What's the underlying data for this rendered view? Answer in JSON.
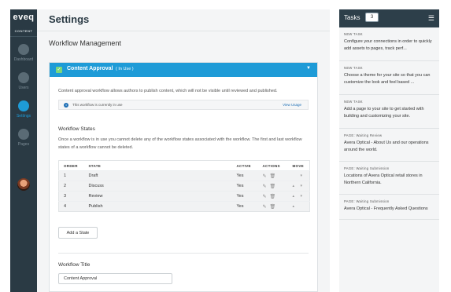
{
  "sidebar": {
    "logo": "eveq",
    "logo_sub": "CONTENT",
    "items": [
      {
        "label": "Dashboard",
        "icon": "gauge-icon"
      },
      {
        "label": "Users",
        "icon": "users-icon"
      },
      {
        "label": "Settings",
        "icon": "gear-icon",
        "active": true
      },
      {
        "label": "Pages",
        "icon": "pages-icon"
      }
    ]
  },
  "header": {
    "title": "Settings"
  },
  "main": {
    "section_title": "Workflow Management",
    "card": {
      "title": "Content Approval",
      "badge": "( In Use )",
      "description": "Content approval workflow allows authors to publish content, which will not be visible until reviewed and published.",
      "info_text": "This workflow is currently in use",
      "info_link": "View Usage",
      "states_title": "Workflow States",
      "states_description": "Once a workflow is in use you cannot delete any of the workflow states associated with the workflow. The first and last workflow states of a workflow cannot be deleted.",
      "table": {
        "headers": [
          "ORDER",
          "STATE",
          "ACTIVE",
          "ACTIONS",
          "MOVE"
        ],
        "rows": [
          {
            "order": "1",
            "state": "Draft",
            "active": "Yes"
          },
          {
            "order": "2",
            "state": "Discuss",
            "active": "Yes"
          },
          {
            "order": "3",
            "state": "Review",
            "active": "Yes"
          },
          {
            "order": "4",
            "state": "Publish",
            "active": "Yes"
          }
        ]
      },
      "add_button": "Add a State",
      "workflow_title_label": "Workflow Title",
      "workflow_title_value": "Content Approval"
    }
  },
  "tasks": {
    "title": "Tasks",
    "count": "3",
    "items": [
      {
        "type": "NEW TASK",
        "text": "Configure your connections in order to quickly add assets to pages, track perf..."
      },
      {
        "type": "NEW TASK",
        "text": "Choose a theme for your site so that you can customize the look and feel based ..."
      },
      {
        "type": "NEW TASK",
        "text": "Add a page to your site to get started with building and customizing your site."
      },
      {
        "type": "PAGE: Waiting Review",
        "text": "Avera Optical - About Us and our operations around the world."
      },
      {
        "type": "PAGE: Waiting Submission",
        "text": "Locations of Avera Optical retail stores in Northern California."
      },
      {
        "type": "PAGE: Waiting Submission",
        "text": "Avera Optical - Frequently Asked Questions"
      }
    ]
  },
  "colors": {
    "accent": "#1e9bd7",
    "nav_bg": "#2a3a44",
    "tasks_header_bg": "#2d3f4a"
  }
}
